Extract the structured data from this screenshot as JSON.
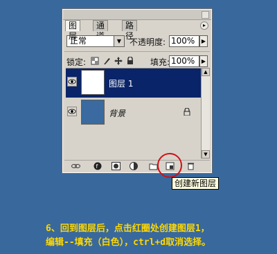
{
  "tabs": [
    {
      "label": "图层",
      "active": true
    },
    {
      "label": "通道",
      "active": false
    },
    {
      "label": "路径",
      "active": false
    }
  ],
  "blend_mode": "正常",
  "opacity_label": "不透明度:",
  "opacity_value": "100%",
  "lock_label": "锁定:",
  "fill_label": "填充:",
  "fill_value": "100%",
  "layers": [
    {
      "name": "图层 1",
      "selected": true
    },
    {
      "name": "背景",
      "selected": false
    }
  ],
  "tooltip": "创建新图层",
  "caption": {
    "line1": "6、回到图层后，点击红圈处创建图层1，",
    "line2": "编辑--填充（白色），ctrl+d取消选择。"
  },
  "colors": {
    "background": "#39689c",
    "selected_layer": "#0a246a",
    "highlight_circle": "#d10f16",
    "caption": "#ffd800"
  }
}
